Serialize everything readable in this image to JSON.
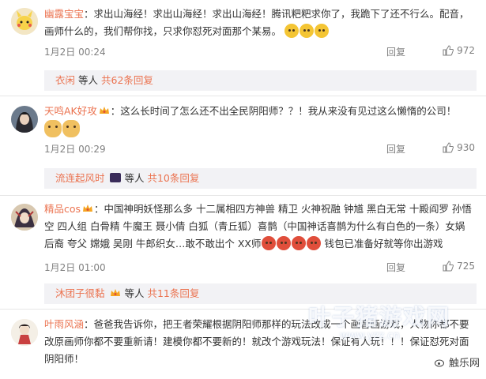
{
  "comments": [
    {
      "user": "幽露宝宝",
      "text": "：求出山海经！求出山海经！求出山海经！腾讯粑粑求你了，我跪下了还不行么。配音，画师什么的，我们帮你找，只求你怼死对面那个某易。",
      "date": "1月2日 00:24",
      "reply": "回复",
      "likes": "972",
      "sub_name": "衣闲",
      "sub_text": "等人",
      "sub_count": "共62条回复",
      "emojis": [
        "sad-face-emoji",
        "crying-face-emoji",
        "crying-face-emoji"
      ]
    },
    {
      "user": "天鸣AK好攻",
      "text": "：这么长时间了怎么还不出全民阴阳师？？！我从来没有见过这么懒惰的公司！",
      "date": "1月2日 00:29",
      "reply": "回复",
      "likes": "930",
      "sub_name": "流连起风时",
      "sub_text": "等人",
      "sub_count": "共10条回复",
      "emojis": [
        "doge-emoji",
        "doge-emoji"
      ]
    },
    {
      "user": "精品cos",
      "text_a": "：中国神明妖怪那么多 十二属相四方神兽 精卫 火神祝融 钟馗 黑白无常 十殿阎罗 孙悟空 四人组 白骨精 牛魔王 聂小倩 白狐（青丘狐）喜鹊（中国神话喜鹊为什么有白色的一条）女娲 后裔 夸父 嫦娥 吴刚 牛郎织女…敢不敢出个 XX师",
      "text_b": "钱包已准备好就等你出游戏",
      "date": "1月2日 01:00",
      "reply": "回复",
      "likes": "725",
      "sub_name": "沐团子很黏",
      "sub_text": "等人",
      "sub_count": "共11条回复"
    },
    {
      "user": "叶雨风涵",
      "text": "：爸爸我告诉你，把王者荣耀根据阴阳师那样的玩法改成一个画音画游戏，人物你都不要改原画师你都不要重新请！建模你都不要新的！就改个游戏玩法！保证有人玩！！！保证怼死对面阴阳师！"
    }
  ],
  "watermark": "叶子猪游戏网",
  "watermark_url": "www.yzz.cn",
  "site_mark": "触乐网",
  "colors": {
    "username": "#eb7350",
    "meta": "#808080",
    "subbox_bg": "#f2f2f5"
  }
}
